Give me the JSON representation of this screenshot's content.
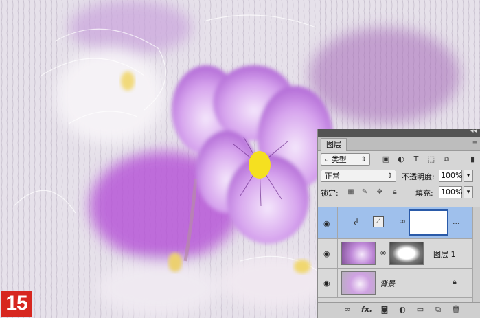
{
  "step_number": "15",
  "panel": {
    "title": "图层",
    "filter": {
      "label": "类型",
      "icon": "search-icon"
    },
    "blend_mode": "正常",
    "opacity_label": "不透明度:",
    "opacity_value": "100%",
    "lock_label": "锁定:",
    "fill_label": "填充:",
    "fill_value": "100%",
    "menu_glyph": "≡",
    "collapse_glyph": "◂◂",
    "layers": [
      {
        "type": "adjustment",
        "selected": true,
        "more": "..."
      },
      {
        "type": "image",
        "name": "图层 1",
        "selected": false
      },
      {
        "type": "background",
        "name": "背景",
        "selected": false,
        "locked": true
      }
    ],
    "fx_label": "fx."
  },
  "colors": {
    "panel_bg": "#d6d6d6",
    "selected_layer": "#9fc0ec",
    "step_badge": "#d7261f",
    "flower_purple": "#b571d6"
  }
}
